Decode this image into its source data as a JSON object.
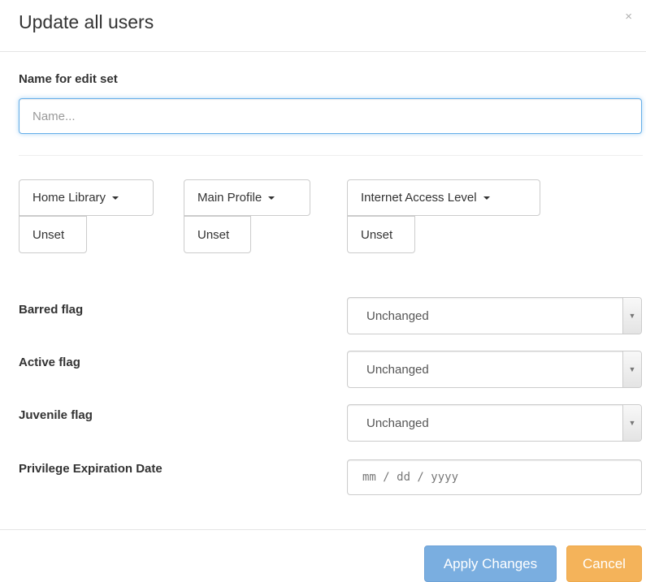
{
  "modal": {
    "title": "Update all users",
    "close_glyph": "×"
  },
  "name_field": {
    "label": "Name for edit set",
    "placeholder": "Name...",
    "value": ""
  },
  "dropdowns": [
    {
      "label": "Home Library",
      "unset_label": "Unset"
    },
    {
      "label": "Main Profile",
      "unset_label": "Unset"
    },
    {
      "label": "Internet Access Level",
      "unset_label": "Unset"
    }
  ],
  "flags": [
    {
      "label": "Barred flag",
      "value": "Unchanged"
    },
    {
      "label": "Active flag",
      "value": "Unchanged"
    },
    {
      "label": "Juvenile flag",
      "value": "Unchanged"
    }
  ],
  "expiration": {
    "label": "Privilege Expiration Date",
    "placeholder": "mm / dd / yyyy"
  },
  "footer": {
    "apply_label": "Apply Changes",
    "cancel_label": "Cancel"
  },
  "colors": {
    "apply_button": "#7aaee0",
    "cancel_button": "#f4b35a",
    "focus_border": "#66afe9"
  },
  "icons": {
    "close": "close-icon",
    "caret": "caret-down-icon",
    "select_arrow": "chevron-updown-icon"
  }
}
